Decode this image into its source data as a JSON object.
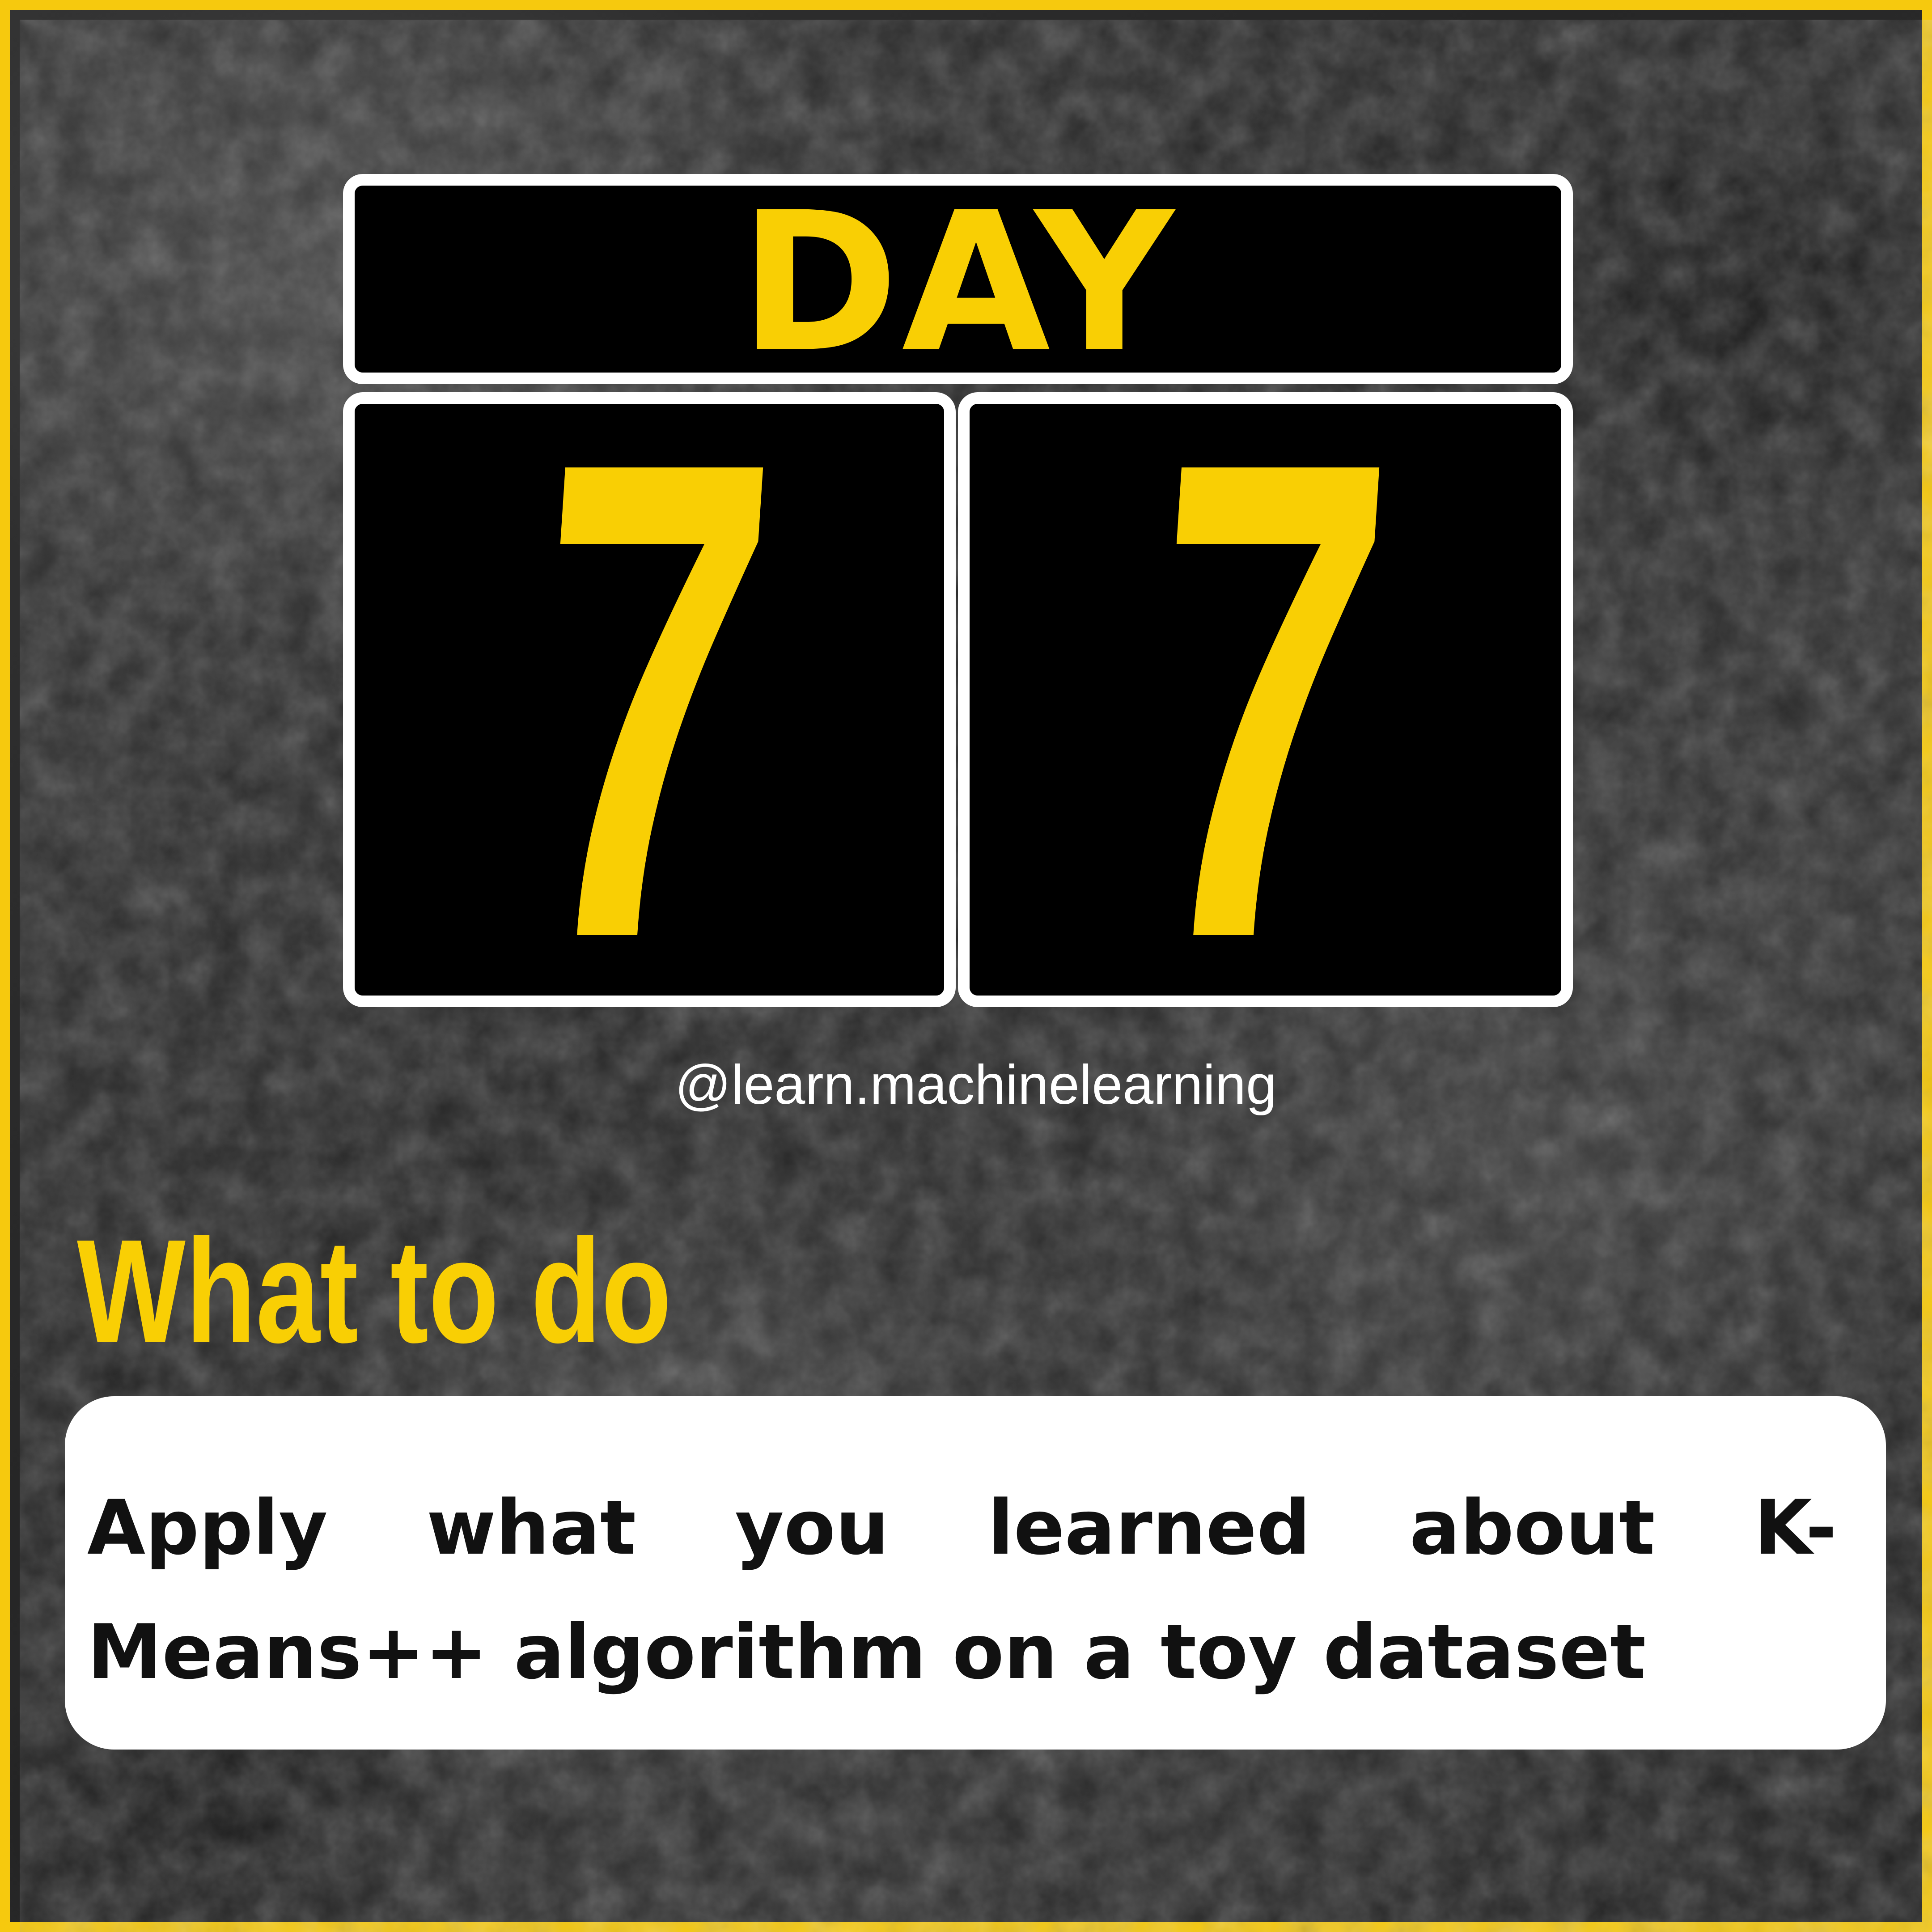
{
  "calendar": {
    "label": "DAY",
    "digits": [
      "7",
      "7"
    ]
  },
  "handle": "@learn.machinelearning",
  "section": {
    "heading": "What to do",
    "body": "Apply what you learned about K-Means++ algorithm on a toy dataset"
  },
  "colors": {
    "accent": "#f9cf04",
    "frame": "#f6c90e",
    "tile_border": "#ffffff",
    "background": "#2a2a2a"
  }
}
